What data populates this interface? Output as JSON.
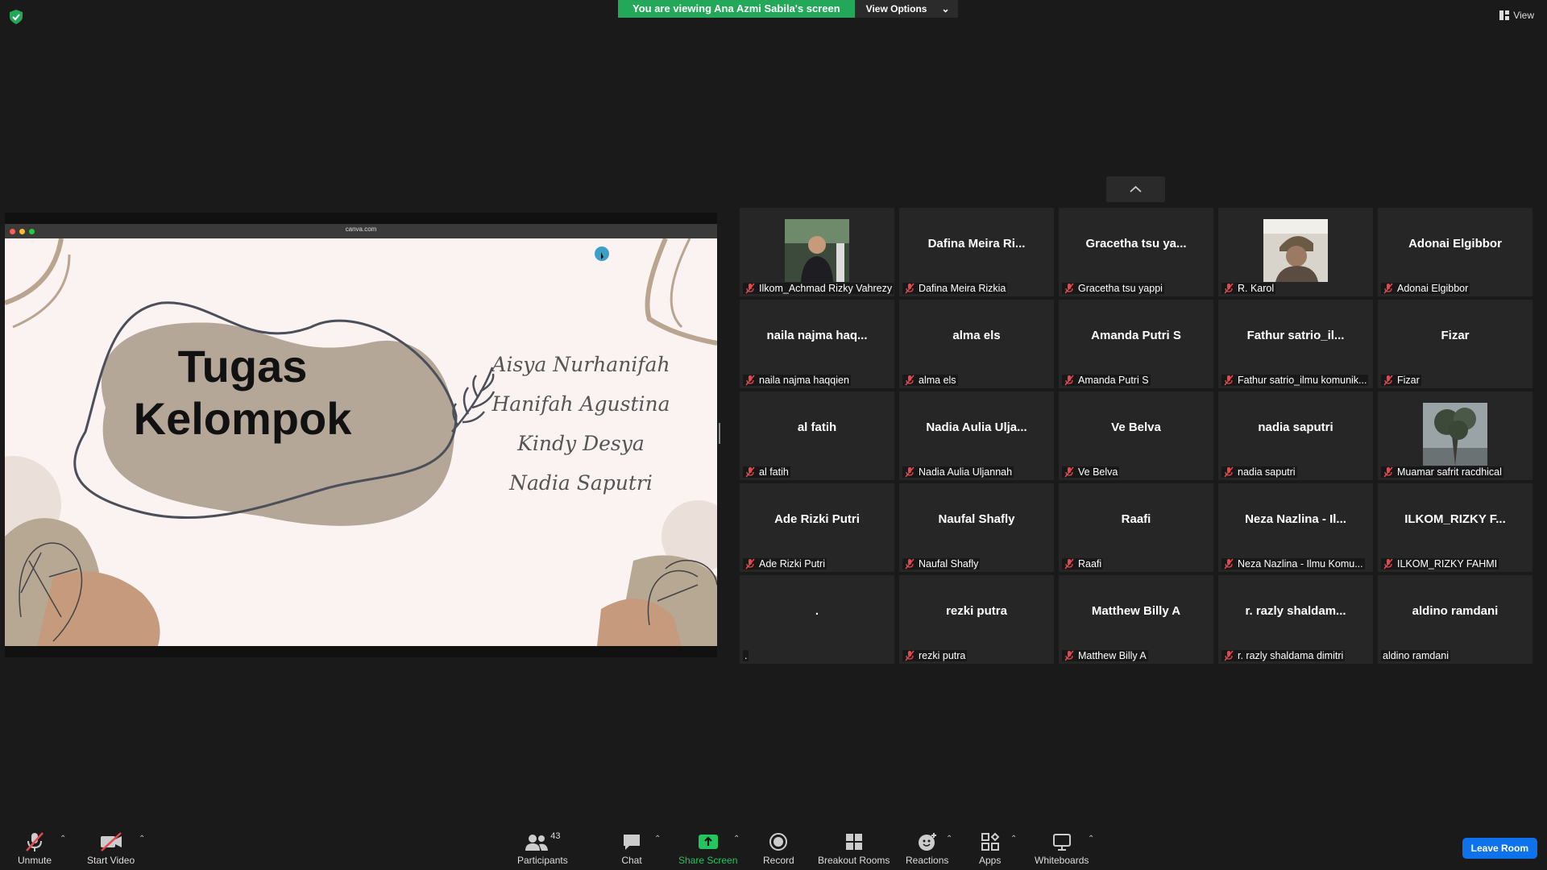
{
  "banner": {
    "viewing_text": "You are viewing Ana Azmi Sabila's screen",
    "view_options_label": "View Options"
  },
  "top_right": {
    "view_label": "View"
  },
  "shared_screen": {
    "url": "canva.com",
    "slide_title_line1": "Tugas",
    "slide_title_line2": "Kelompok",
    "members": [
      "Aisya Nurhanifah",
      "Hanifah Agustina",
      "Kindy Desya",
      "Nadia Saputri"
    ]
  },
  "participants": [
    {
      "title": "",
      "name": "Ilkom_Achmad Rizky Vahrezy",
      "muted": true,
      "video": "photo-portrait"
    },
    {
      "title": "Dafina Meira Ri...",
      "name": "Dafina Meira Rizkia",
      "muted": true
    },
    {
      "title": "Gracetha tsu ya...",
      "name": "Gracetha tsu yappi",
      "muted": true
    },
    {
      "title": "",
      "name": "R. Karol",
      "muted": true,
      "video": "photo-selfie"
    },
    {
      "title": "Adonai Elgibbor",
      "name": "Adonai Elgibbor",
      "muted": true
    },
    {
      "title": "naila  najma  haq...",
      "name": "naila najma haqqien",
      "muted": true
    },
    {
      "title": "alma els",
      "name": "alma els",
      "muted": true
    },
    {
      "title": "Amanda Putri S",
      "name": "Amanda Putri S",
      "muted": true
    },
    {
      "title": "Fathur  satrio_il...",
      "name": "Fathur satrio_ilmu komunik...",
      "muted": true
    },
    {
      "title": "Fizar",
      "name": "Fizar",
      "muted": true
    },
    {
      "title": "al fatih",
      "name": "al fatih",
      "muted": true
    },
    {
      "title": "Nadia Aulia Ulja...",
      "name": "Nadia Aulia Uljannah",
      "muted": true
    },
    {
      "title": "Ve Belva",
      "name": "Ve Belva",
      "muted": true
    },
    {
      "title": "nadia saputri",
      "name": "nadia saputri",
      "muted": true
    },
    {
      "title": "",
      "name": "Muamar safrit racdhical",
      "muted": true,
      "video": "photo-tree"
    },
    {
      "title": "Ade Rizki Putri",
      "name": "Ade Rizki Putri",
      "muted": true
    },
    {
      "title": "Naufal Shafly",
      "name": "Naufal Shafly",
      "muted": true
    },
    {
      "title": "Raafi",
      "name": "Raafi",
      "muted": true
    },
    {
      "title": "Neza Nazlina - Il...",
      "name": "Neza Nazlina - Ilmu Komu...",
      "muted": true
    },
    {
      "title": "ILKOM_RIZKY F...",
      "name": "ILKOM_RIZKY FAHMI",
      "muted": true
    },
    {
      "title": ".",
      "name": ".",
      "muted": false
    },
    {
      "title": "rezki putra",
      "name": "rezki putra",
      "muted": true
    },
    {
      "title": "Matthew Billy A",
      "name": "Matthew Billy A",
      "muted": true
    },
    {
      "title": "r.  razly  shaldam...",
      "name": "r. razly shaldama dimitri",
      "muted": true
    },
    {
      "title": "aldino ramdani",
      "name": "aldino ramdani",
      "muted": false
    }
  ],
  "toolbar": {
    "unmute": "Unmute",
    "start_video": "Start Video",
    "participants": "Participants",
    "participants_count": "43",
    "chat": "Chat",
    "share_screen": "Share Screen",
    "record": "Record",
    "breakout_rooms": "Breakout Rooms",
    "reactions": "Reactions",
    "apps": "Apps",
    "whiteboards": "Whiteboards",
    "leave": "Leave Room"
  },
  "colors": {
    "share_green": "#23c55e",
    "leave_blue": "#0e72ed",
    "mute_red": "#e5484d"
  }
}
